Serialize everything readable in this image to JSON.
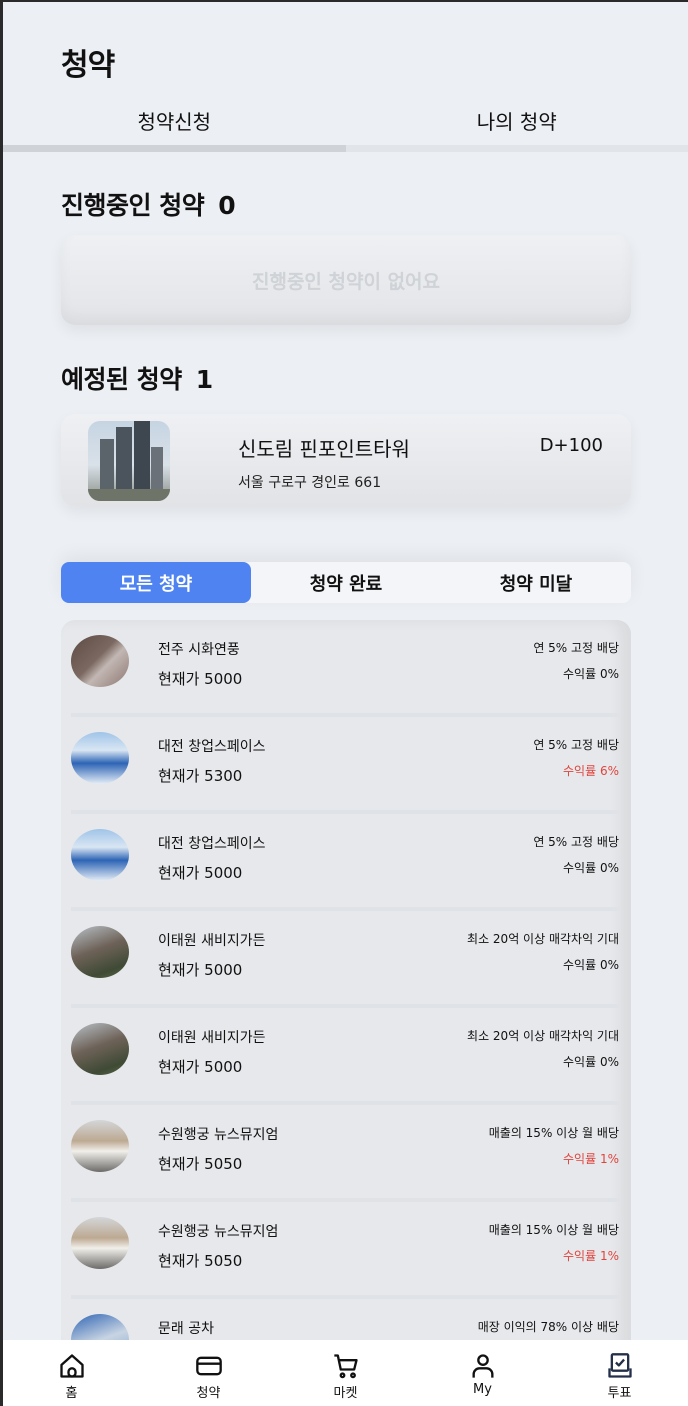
{
  "header": {
    "title": "청약"
  },
  "top_tabs": [
    {
      "label": "청약신청",
      "active": true
    },
    {
      "label": "나의 청약",
      "active": false
    }
  ],
  "ongoing": {
    "title": "진행중인 청약",
    "count": "0",
    "empty_text": "진행중인 청약이 없어요"
  },
  "scheduled": {
    "title": "예정된 청약",
    "count": "1",
    "items": [
      {
        "name": "신도림 핀포인트타워",
        "address": "서울 구로구 경인로 661",
        "dday": "D+100"
      }
    ]
  },
  "filters": [
    {
      "label": "모든 청약",
      "active": true
    },
    {
      "label": "청약 완료",
      "active": false
    },
    {
      "label": "청약 미달",
      "active": false
    }
  ],
  "listings": [
    {
      "name": "전주 시화연풍",
      "price": "현재가 5000",
      "desc": "연 5% 고정 배당",
      "rate": "수익률 0%",
      "positive": false,
      "thumb": "brick"
    },
    {
      "name": "대전 창업스페이스",
      "price": "현재가 5300",
      "desc": "연 5% 고정 배당",
      "rate": "수익률 6%",
      "positive": true,
      "thumb": "blue"
    },
    {
      "name": "대전 창업스페이스",
      "price": "현재가 5000",
      "desc": "연 5% 고정 배당",
      "rate": "수익률 0%",
      "positive": false,
      "thumb": "blue"
    },
    {
      "name": "이태원 새비지가든",
      "price": "현재가 5000",
      "desc": "최소 20억 이상 매각차익 기대",
      "rate": "수익률 0%",
      "positive": false,
      "thumb": "garden"
    },
    {
      "name": "이태원 새비지가든",
      "price": "현재가 5000",
      "desc": "최소 20억 이상 매각차익 기대",
      "rate": "수익률 0%",
      "positive": false,
      "thumb": "garden"
    },
    {
      "name": "수원행궁 뉴스뮤지엄",
      "price": "현재가 5050",
      "desc": "매출의 15% 이상 월 배당",
      "rate": "수익률 1%",
      "positive": true,
      "thumb": "museum"
    },
    {
      "name": "수원행궁 뉴스뮤지엄",
      "price": "현재가 5050",
      "desc": "매출의 15% 이상 월 배당",
      "rate": "수익률 1%",
      "positive": true,
      "thumb": "museum"
    },
    {
      "name": "문래 공차",
      "price": "",
      "desc": "매장 이익의 78% 이상 배당",
      "rate": "",
      "positive": false,
      "thumb": "shop"
    }
  ],
  "bottom_nav": [
    {
      "label": "홈",
      "icon": "home-icon"
    },
    {
      "label": "청약",
      "icon": "card-icon"
    },
    {
      "label": "마켓",
      "icon": "cart-icon"
    },
    {
      "label": "My",
      "icon": "user-icon"
    },
    {
      "label": "투표",
      "icon": "vote-icon"
    }
  ]
}
